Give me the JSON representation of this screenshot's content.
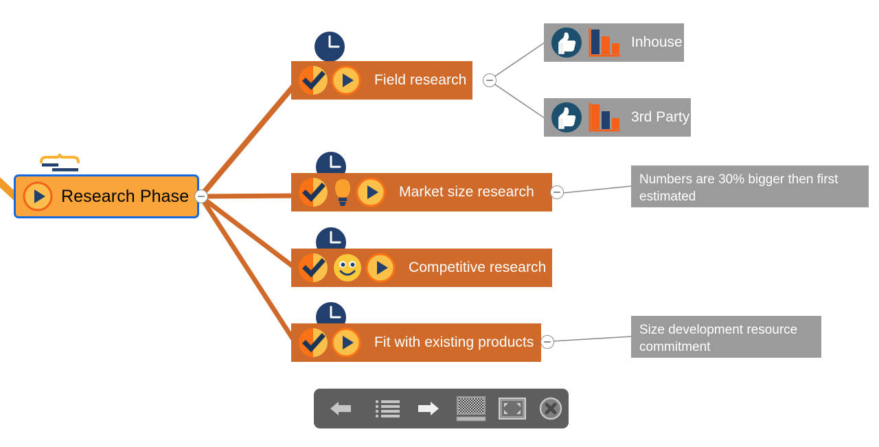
{
  "app": {
    "title": "Mind map presentation view",
    "background_color": "#ffffff"
  },
  "colors": {
    "root_fill": "#f9a53a",
    "root_border": "#1769e0",
    "task_fill": "#cf6a2a",
    "leaf_fill": "#9b9b9b",
    "note_fill": "#9b9b9b",
    "edge_main": "#cf6a2a",
    "edge_sub": "#8c8c8c",
    "icon_navy": "#22406e",
    "icon_orange": "#f97316",
    "icon_gold": "#fbc02d",
    "toolbar_fill": "#5e5e5e",
    "toolbar_icon": "#c6c6c6"
  },
  "root": {
    "label": "Research Phase",
    "play_icon": "play-circle-icon",
    "note_icon": "note-bracket-icon",
    "collapse_icon": "collapse-minus-icon"
  },
  "branches": [
    {
      "label": "Field research",
      "clock_icon": "clock-icon",
      "check_icon": "task-progress-half-check-icon",
      "play_icon": "play-circle-icon",
      "collapse_icon": "collapse-minus-icon",
      "extra_icon": null
    },
    {
      "label": "Market size research",
      "clock_icon": "clock-icon",
      "check_icon": "task-progress-half-check-icon",
      "play_icon": "play-circle-icon",
      "collapse_icon": "collapse-minus-icon",
      "extra_icon": "lightbulb-idea-icon"
    },
    {
      "label": "Competitive research",
      "clock_icon": "clock-icon",
      "check_icon": "task-progress-half-check-icon",
      "play_icon": "play-circle-icon",
      "collapse_icon": null,
      "extra_icon": "smiley-face-icon"
    },
    {
      "label": "Fit with existing products",
      "clock_icon": "clock-icon",
      "check_icon": "task-progress-half-check-icon",
      "play_icon": "play-circle-icon",
      "collapse_icon": "collapse-minus-icon",
      "extra_icon": null
    }
  ],
  "leaves": [
    {
      "label": "Inhouse",
      "thumb_icon": "thumbs-up-icon",
      "chart_icon": "bar-chart-icon",
      "bar_colors": [
        "#22406e",
        "#f4601a",
        "#f4601a"
      ],
      "bar_heights": [
        34,
        24,
        16
      ]
    },
    {
      "label": "3rd Party",
      "thumb_icon": "thumbs-up-icon",
      "chart_icon": "bar-chart-icon",
      "bar_colors": [
        "#f4601a",
        "#22406e",
        "#f4601a"
      ],
      "bar_heights": [
        34,
        24,
        16
      ]
    }
  ],
  "notes": [
    {
      "text": "Numbers are 30% bigger then first\nestimated"
    },
    {
      "text": "Size development resource\ncommitment"
    }
  ],
  "toolbar": {
    "buttons": [
      {
        "name": "previous-slide-button",
        "icon": "arrow-left-icon",
        "label": "Previous"
      },
      {
        "name": "outline-list-button",
        "icon": "list-lines-icon",
        "label": "Outline"
      },
      {
        "name": "next-slide-button",
        "icon": "arrow-right-icon",
        "label": "Next"
      },
      {
        "name": "slide-overview-button",
        "icon": "halftone-screen-icon",
        "label": "Overview"
      },
      {
        "name": "fullscreen-button",
        "icon": "fullscreen-expand-icon",
        "label": "Fullscreen"
      },
      {
        "name": "close-presentation-button",
        "icon": "close-x-circle-icon",
        "label": "Close"
      }
    ]
  }
}
